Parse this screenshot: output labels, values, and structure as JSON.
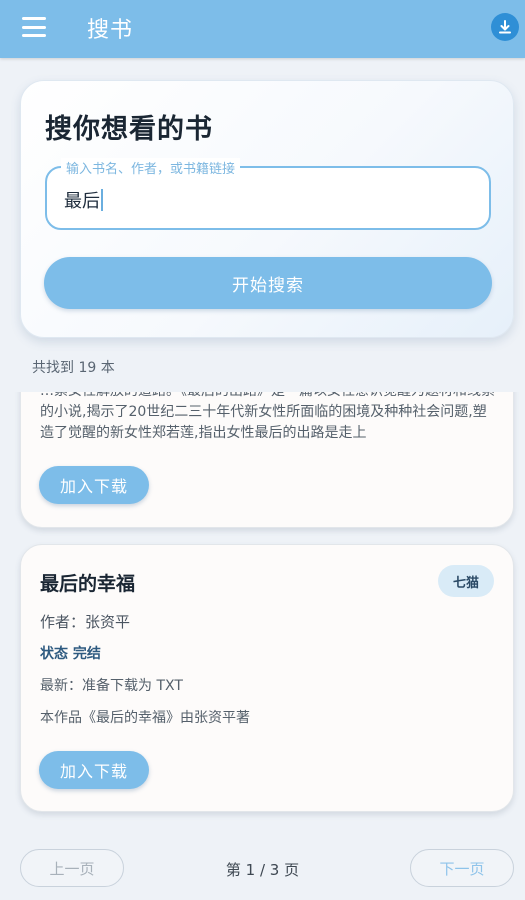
{
  "appbar": {
    "title": "搜书",
    "menu_icon": "hamburger-menu-icon",
    "download_icon": "download-icon"
  },
  "search": {
    "heading": "搜你想看的书",
    "field_label": "输入书名、作者，或书籍链接",
    "field_value": "最后",
    "button_label": "开始搜索"
  },
  "results": {
    "count_text": "共找到 19 本",
    "items": [
      {
        "description": "…素女性解放的道路。《最后的出路》是一篇以女性意识觉醒为题材和线索的小说,揭示了20世纪二三十年代新女性所面临的困境及种种社会问题,塑造了觉醒的新女性郑若莲,指出女性最后的出路是走上",
        "add_label": "加入下载"
      },
      {
        "title": "最后的幸福",
        "source": "七猫",
        "author": "作者：张资平",
        "status": "状态 完结",
        "latest": "最新：准备下载为 TXT",
        "intro": "本作品《最后的幸福》由张资平著",
        "add_label": "加入下载"
      }
    ]
  },
  "pagination": {
    "prev_label": "上一页",
    "page_text": "第 1 / 3 页",
    "next_label": "下一页"
  },
  "colors": {
    "accent": "#7dbde9",
    "appbar": "#7dbde9",
    "download_button": "#2f8fd6",
    "status_text": "#2e5a80"
  }
}
